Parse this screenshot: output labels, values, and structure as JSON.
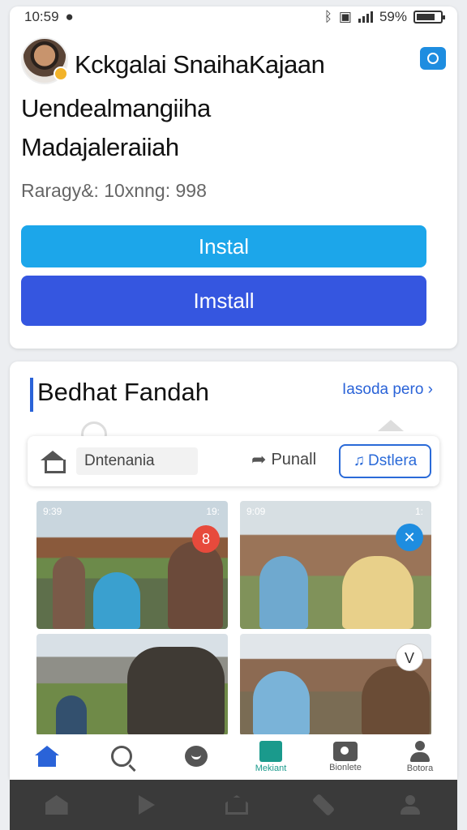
{
  "status": {
    "time": "10:59",
    "battery": "59%",
    "icons": [
      "location-icon",
      "bluetooth-icon",
      "vibrate-icon",
      "signal-icon",
      "battery-icon"
    ]
  },
  "top_card": {
    "title_line1": "Kckgalai SnaihaKajaan",
    "title_line2": "Uendealmangiiha",
    "title_line3": "Madajaleraiiah",
    "meta": "Raragy&: 10xnng: 998",
    "install_primary": "Instal",
    "install_secondary": "Imstall"
  },
  "section": {
    "title": "Bedhat Fandah",
    "link": "Iasoda pero",
    "toolbar": {
      "search_value": "Dntenania",
      "share_label": "Punall",
      "detail_label": "Dstlera"
    },
    "photos": [
      {
        "status_left": "9:39",
        "status_right": "19:",
        "badge": "8"
      },
      {
        "status_left": "9:09",
        "status_right": "1:",
        "badge": "✕"
      },
      {
        "badge": ""
      },
      {
        "badge": "V"
      }
    ]
  },
  "bottom_nav": {
    "items": [
      {
        "label": ""
      },
      {
        "label": ""
      },
      {
        "label": ""
      },
      {
        "label": "Mekiant"
      },
      {
        "label": "Bionlete"
      },
      {
        "label": "Botora"
      }
    ]
  },
  "colors": {
    "primary_blue": "#1ca6ea",
    "secondary_blue": "#3556e0",
    "accent_teal": "#1a9a8c",
    "link_blue": "#2a63d8"
  }
}
